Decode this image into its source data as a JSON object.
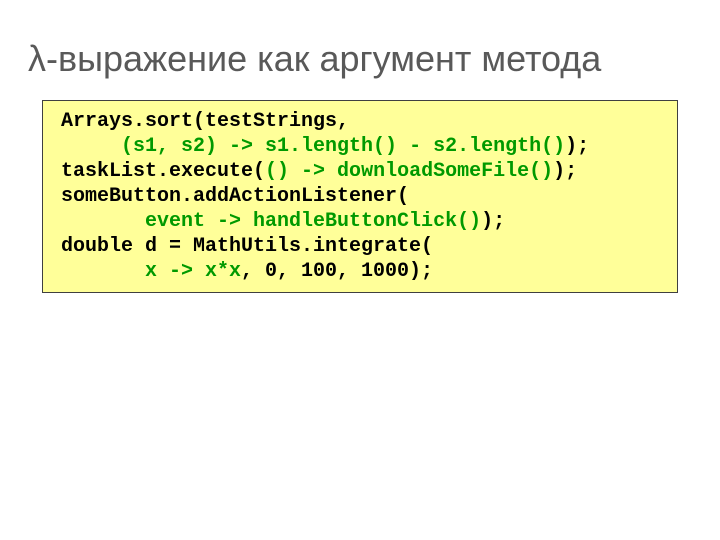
{
  "title": "λ-выражение как аргумент метода",
  "code": {
    "l1": " Arrays.sort(testStrings,",
    "l2a": "      ",
    "l2b": "(s1, s2) -> s1.length() - s2.length()",
    "l2c": ");",
    "l3a": " taskList.execute(",
    "l3b": "() -> downloadSomeFile()",
    "l3c": ");",
    "l4": " someButton.addActionListener(",
    "l5a": "        ",
    "l5b": "event -> handleButtonClick()",
    "l5c": ");",
    "l6": " double d = MathUtils.integrate(",
    "l7a": "        ",
    "l7b": "x -> x*x",
    "l7c": ", 0, 100, 1000);"
  }
}
